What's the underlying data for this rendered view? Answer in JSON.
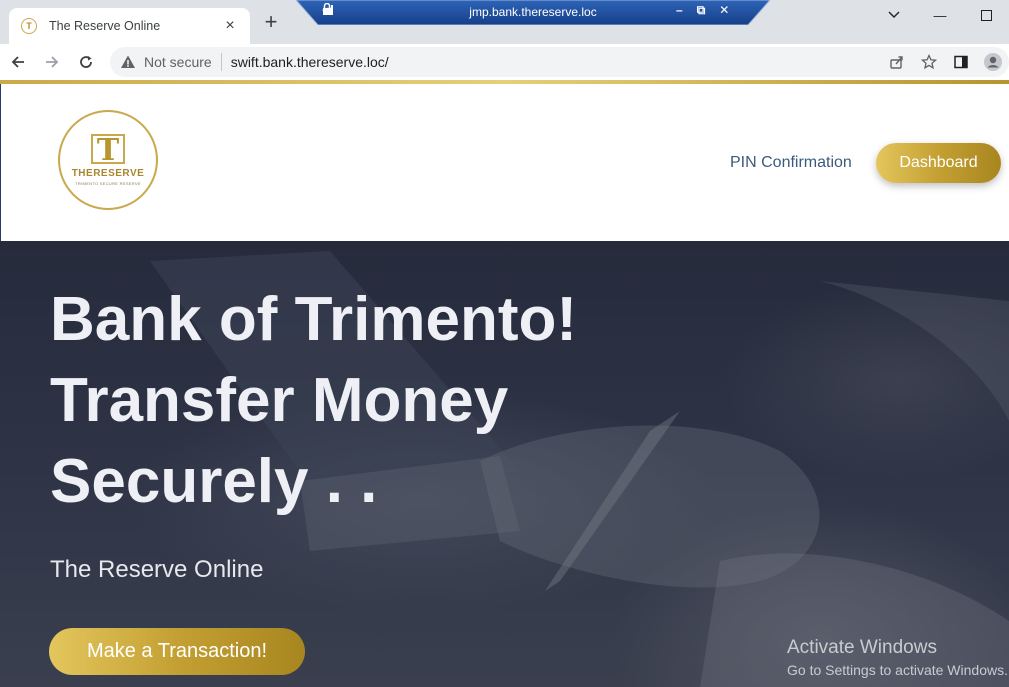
{
  "browser": {
    "tab_title": "The Reserve Online",
    "tab_close": "×",
    "new_tab": "+",
    "security_label": "Not secure",
    "url": "swift.bank.thereserve.loc/",
    "window_controls": {
      "minimize": "—",
      "restore": "☐"
    }
  },
  "remote_session": {
    "title": "jmp.bank.thereserve.loc"
  },
  "site": {
    "logo": {
      "mark": "T",
      "wordmark": "THERESERVE",
      "tagline": "TRIMENTO SECURE RESERVE"
    },
    "nav": {
      "pin_confirmation": "PIN Confirmation",
      "dashboard": "Dashboard"
    },
    "hero": {
      "line1": "Bank of Trimento!",
      "line2": "Transfer Money",
      "line3": "Securely . .",
      "subtitle": "The Reserve Online",
      "cta": "Make a Transaction!"
    }
  },
  "os_watermark": {
    "title": "Activate Windows",
    "subtitle": "Go to Settings to activate Windows."
  },
  "colors": {
    "gold_accent": "#c4a033",
    "nav_link": "#3b5b7e",
    "hero_background": "#2b3042",
    "remote_bar": "#1f4e9c"
  },
  "icons": [
    "favicon-icon",
    "back-icon",
    "forward-icon",
    "reload-icon",
    "warning-icon",
    "share-icon",
    "star-icon",
    "sidepanel-icon",
    "profile-icon",
    "pin-icon",
    "lock-icon",
    "signal-icon",
    "chevron-down-icon"
  ]
}
